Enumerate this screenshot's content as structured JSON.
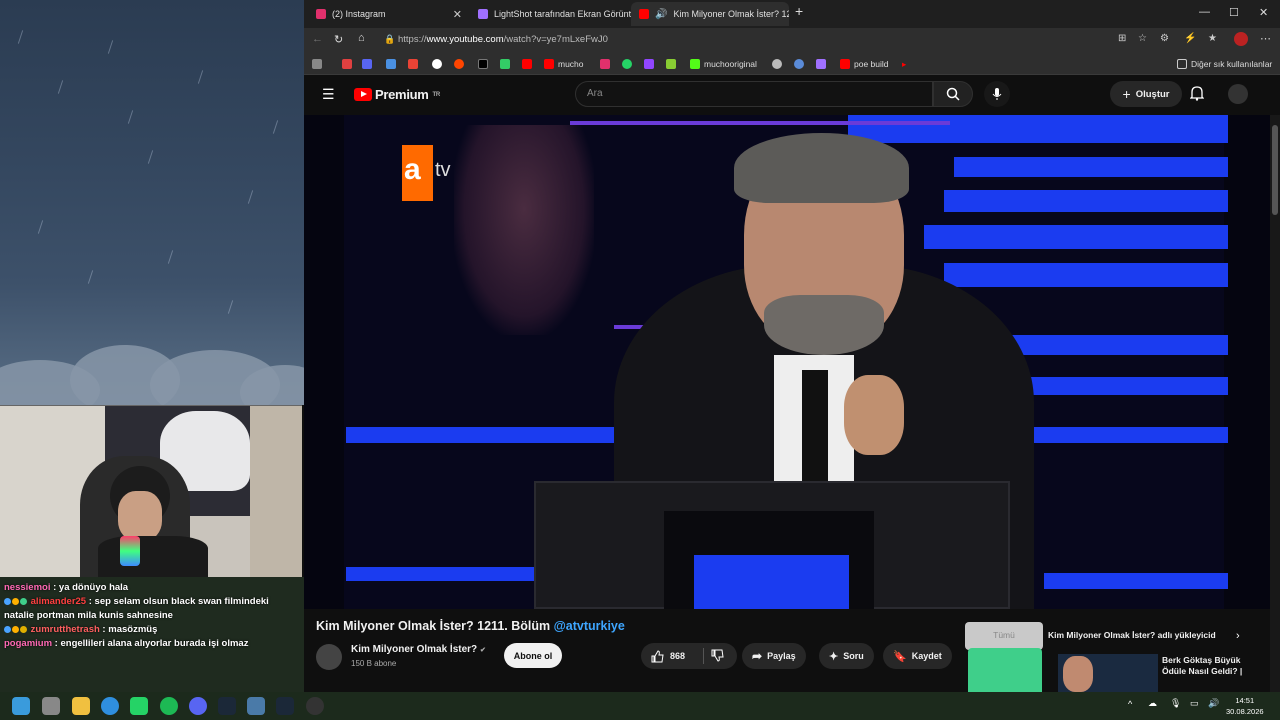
{
  "browser": {
    "tabs": [
      {
        "label": "(2) Instagram",
        "color": "#e1306c"
      },
      {
        "label": "LightShot tarafından Ekran Görünt",
        "color": "#a070ff"
      },
      {
        "label": "Kim Milyoner Olmak İster? 12",
        "color": "#ff0000"
      }
    ],
    "url_prefix": "https://",
    "url_host": "www.youtube.com",
    "url_path": "/watch?v=ye7mLxeFwJ0",
    "bookmarks": [
      {
        "label": "mucho"
      },
      {
        "label": "muchooriginal"
      },
      {
        "label": "poe build"
      }
    ],
    "other_bookmarks": "Diğer sık kullanılanlar"
  },
  "youtube": {
    "logo_text": "Premium",
    "logo_region": "TR",
    "search_placeholder": "Ara",
    "create_label": "Oluştur",
    "video": {
      "channel_logo_a": "a",
      "channel_logo_tv": "tv"
    },
    "title_main": "Kim Milyoner Olmak İster? 1211. Bölüm ",
    "title_tag": "@atvturkiye",
    "channel": {
      "name": "Kim Milyoner Olmak İster?",
      "verified": "✔",
      "subscribers": "150 B abone"
    },
    "subscribe_label": "Abone ol",
    "likes": "868",
    "share_label": "Paylaş",
    "ask_label": "Soru",
    "save_label": "Kaydet",
    "suggestions": {
      "header": "Kim Milyoner Olmak İster? adlı yükleyicid",
      "filter_all": "Tümü",
      "first_title": "Berk Göktaş Büyük Ödüle Nasıl Geldi? |"
    }
  },
  "stream_chat": [
    {
      "user": "nessiemoi",
      "color": "#ff69b4",
      "text": "ya dönüyo hala"
    },
    {
      "user": "alimander25",
      "color": "#ff4040",
      "text": "sep selam olsun black swan filmindeki natalie portman mila kunis sahnesine"
    },
    {
      "user": "zumrutthetrash",
      "color": "#ff6060",
      "text": "masözmüş"
    },
    {
      "user": "pogamium",
      "color": "#ff69b4",
      "text": "engellileri alana alıyorlar burada işi olmaz"
    }
  ],
  "taskbar": {
    "time": "14:51",
    "date": "30.08.2026"
  }
}
